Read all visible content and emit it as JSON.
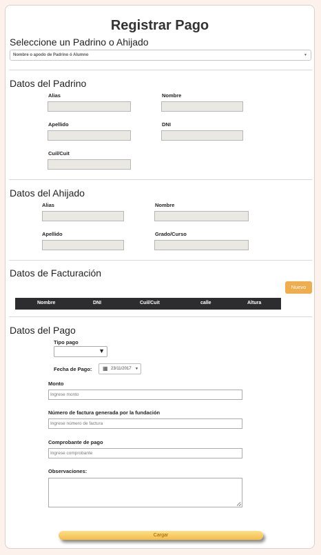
{
  "title": "Registrar Pago",
  "selector": {
    "heading": "Seleccione un Padrino o Ahijado",
    "placeholder": "Nombre o apodo de Padrino ó Alumno"
  },
  "padrino": {
    "heading": "Datos del Padrino",
    "alias": "Alias",
    "nombre": "Nombre",
    "apellido": "Apellido",
    "dni": "DNI",
    "cuil": "Cuil/Cuit"
  },
  "ahijado": {
    "heading": "Datos del Ahijado",
    "alias": "Alias",
    "nombre": "Nombre",
    "apellido": "Apellido",
    "grado": "Grado/Curso"
  },
  "facturacion": {
    "heading": "Datos de Facturación",
    "nuevo": "Nuevo",
    "columns": [
      "Nombre",
      "DNI",
      "Cuil/Cuit",
      "calle",
      "Altura"
    ]
  },
  "pago": {
    "heading": "Datos del Pago",
    "tipo_label": "Tipo pago",
    "fecha_label": "Fecha de Pago:",
    "fecha_value": "23/11/2017",
    "monto_label": "Monto",
    "monto_placeholder": "Ingrese monto",
    "factura_label": "Número de factura generada por la fundación",
    "factura_placeholder": "Ingrese número de factura",
    "comprobante_label": "Comprobante de pago",
    "comprobante_placeholder": "Ingrese comprobante",
    "observaciones_label": "Observaciones:"
  },
  "cargar": "Cargar"
}
